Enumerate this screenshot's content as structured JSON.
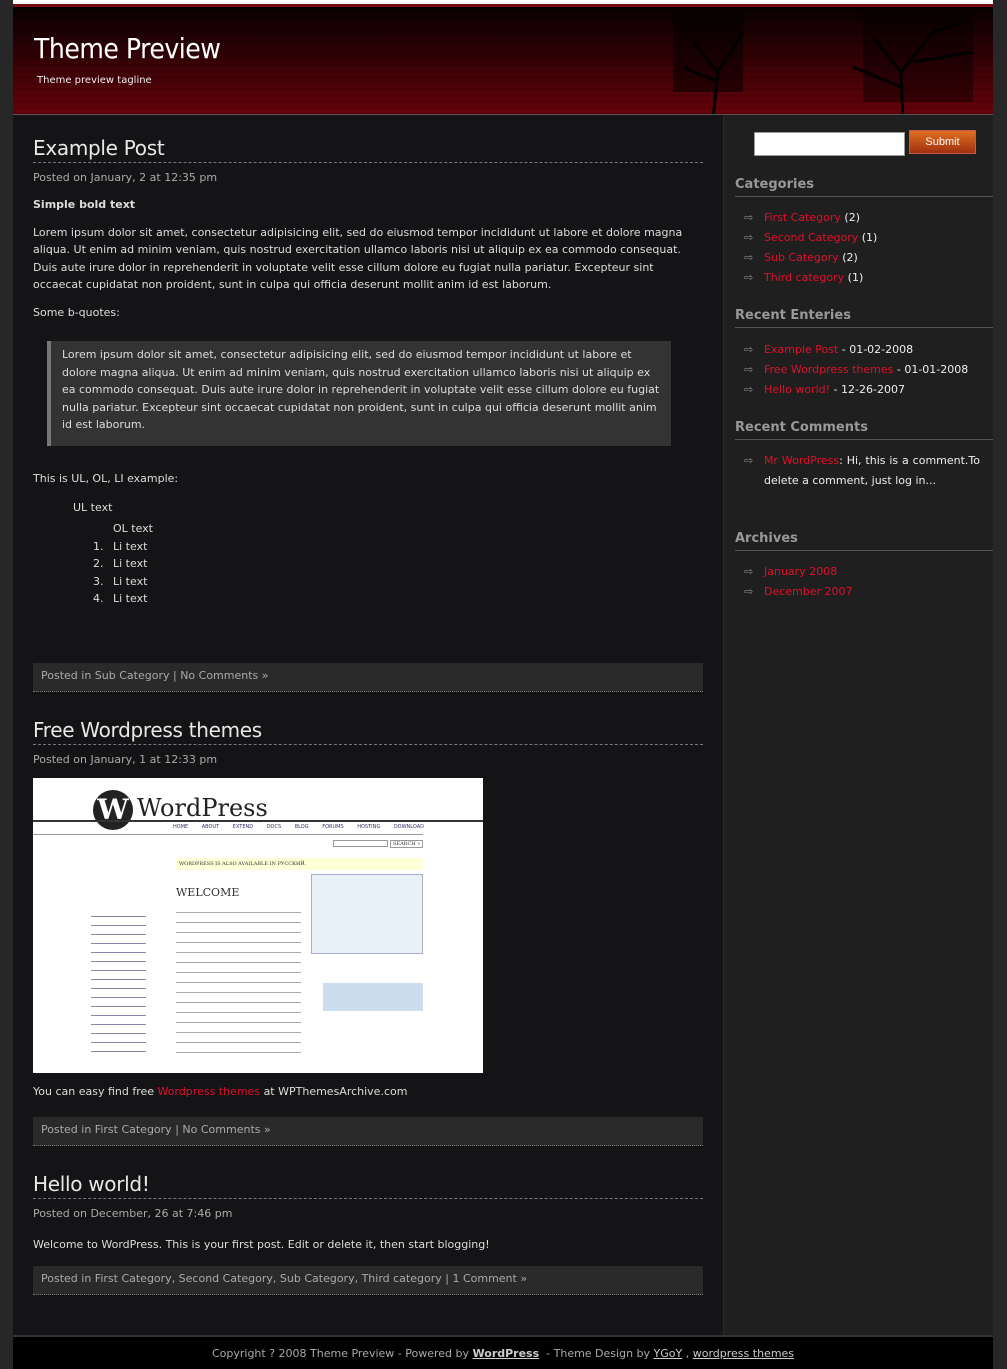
{
  "header": {
    "title": "Theme Preview",
    "tagline": "Theme preview tagline"
  },
  "posts": [
    {
      "title": "Example Post",
      "date": "Posted on January, 2 at 12:35 pm",
      "bold": "Simple bold text",
      "para": "Lorem ipsum dolor sit amet, consectetur adipisicing elit, sed do eiusmod tempor incididunt ut labore et dolore magna aliqua. Ut enim ad minim veniam, quis nostrud exercitation ullamco laboris nisi ut aliquip ex ea commodo consequat. Duis aute irure dolor in reprehenderit in voluptate velit esse cillum dolore eu fugiat nulla pariatur. Excepteur sint occaecat cupidatat non proident, sunt in culpa qui officia deserunt mollit anim id est laborum.",
      "bq_intro": "Some b-quotes:",
      "quote": "Lorem ipsum dolor sit amet, consectetur adipisicing elit, sed do eiusmod tempor incididunt ut labore et dolore magna aliqua. Ut enim ad minim veniam, quis nostrud exercitation ullamco laboris nisi ut aliquip ex ea commodo consequat. Duis aute irure dolor in reprehenderit in voluptate velit esse cillum dolore eu fugiat nulla pariatur. Excepteur sint occaecat cupidatat non proident, sunt in culpa qui officia deserunt mollit anim id est laborum.",
      "list_intro": "This is UL, OL, LI example:",
      "ul": "UL text",
      "ol": "OL text",
      "li": [
        "Li text",
        "Li text",
        "Li text",
        "Li text"
      ],
      "meta": {
        "prefix": "Posted in",
        "cats": "Sub Category",
        "comments": "No Comments »"
      }
    },
    {
      "title": "Free Wordpress themes",
      "date": "Posted on January, 1 at 12:33 pm",
      "text_before": "You can easy find free",
      "link": "Wordpress themes",
      "text_after": "at WPThemesArchive.com",
      "meta": {
        "prefix": "Posted in",
        "cats": "First Category",
        "comments": "No Comments »"
      }
    },
    {
      "title": "Hello world!",
      "date": "Posted on December, 26 at 7:46 pm",
      "para": "Welcome to WordPress. This is your first post. Edit or delete it, then start blogging!",
      "meta": {
        "prefix": "Posted in",
        "cats": "First Category, Second Category, Sub Category, Third category",
        "comments": "1 Comment »"
      }
    }
  ],
  "screenshot": {
    "logo": "WordPress",
    "nav": [
      "HOME",
      "ABOUT",
      "EXTEND",
      "DOCS",
      "BLOG",
      "FORUMS",
      "HOSTING",
      "DOWNLOAD"
    ],
    "welcome": "WELCOME",
    "search": "SEARCH »",
    "notice": "WORDPRESS IS ALSO AVAILABLE IN РУССКИЙ."
  },
  "sidebar": {
    "submit": "Submit",
    "categories": {
      "title": "Categories",
      "items": [
        {
          "name": "First Category",
          "count": "(2)"
        },
        {
          "name": "Second Category",
          "count": "(1)"
        },
        {
          "name": "Sub Category",
          "count": "(2)"
        },
        {
          "name": "Third category",
          "count": "(1)"
        }
      ]
    },
    "recent": {
      "title": "Recent Enteries",
      "items": [
        {
          "name": "Example Post",
          "date": "- 01-02-2008"
        },
        {
          "name": "Free Wordpress themes",
          "date": "- 01-01-2008"
        },
        {
          "name": "Hello world!",
          "date": "- 12-26-2007"
        }
      ]
    },
    "comments": {
      "title": "Recent Comments",
      "author": "Mr WordPress",
      "text": ": Hi, this is a comment.To delete a comment, just log in..."
    },
    "archives": {
      "title": "Archives",
      "items": [
        "January 2008",
        "December 2007"
      ]
    }
  },
  "footer": {
    "copy": "Copyright ? 2008 Theme Preview - Powered by",
    "wp": "WordPress",
    "design": "- Theme Design by",
    "ygoy": "YGoY",
    "sep": ",",
    "themes": "wordpress themes"
  },
  "colors": {
    "link": "#e0102a",
    "header": "#5a0008",
    "submit": "#d0601a"
  }
}
